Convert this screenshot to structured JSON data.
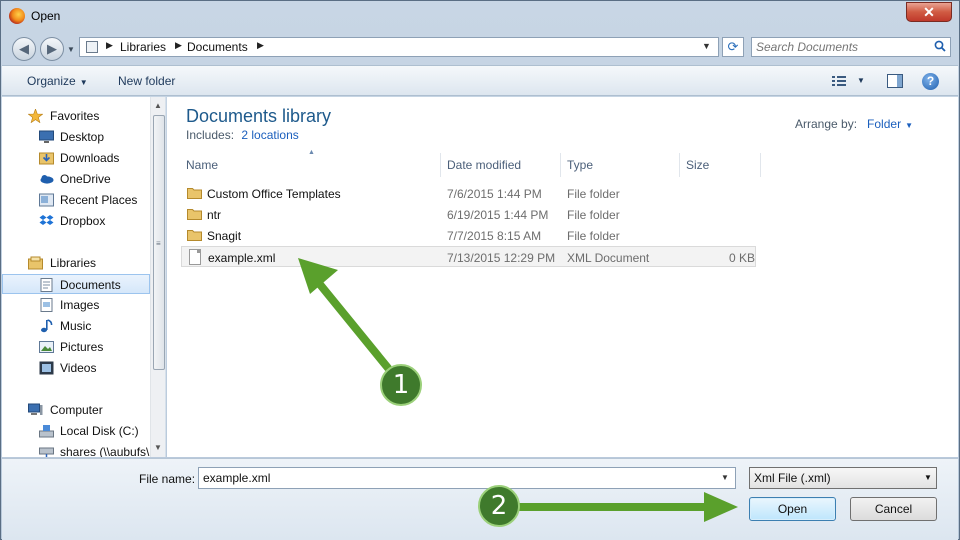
{
  "window": {
    "title": "Open",
    "close_glyph": "✕"
  },
  "address": {
    "crumbs": [
      "Libraries",
      "Documents"
    ],
    "search_placeholder": "Search Documents"
  },
  "toolbar": {
    "organize": "Organize",
    "new_folder": "New folder",
    "help_glyph": "?"
  },
  "nav": {
    "favorites": "Favorites",
    "favorites_items": [
      "Desktop",
      "Downloads",
      "OneDrive",
      "Recent Places",
      "Dropbox"
    ],
    "libraries": "Libraries",
    "libraries_items": [
      "Documents",
      "Images",
      "Music",
      "Pictures",
      "Videos"
    ],
    "computer": "Computer",
    "computer_items": [
      "Local Disk (C:)",
      "shares (\\\\aubufs\\"
    ]
  },
  "content": {
    "title": "Documents library",
    "includes_label": "Includes:",
    "includes_link": "2 locations",
    "arrange_label": "Arrange by:",
    "arrange_value": "Folder",
    "columns": {
      "name": "Name",
      "date": "Date modified",
      "type": "Type",
      "size": "Size"
    },
    "rows": [
      {
        "name": "Custom Office Templates",
        "date": "7/6/2015 1:44 PM",
        "type": "File folder",
        "size": "",
        "kind": "folder"
      },
      {
        "name": "ntr",
        "date": "6/19/2015 1:44 PM",
        "type": "File folder",
        "size": "",
        "kind": "folder"
      },
      {
        "name": "Snagit",
        "date": "7/7/2015 8:15 AM",
        "type": "File folder",
        "size": "",
        "kind": "folder"
      },
      {
        "name": "example.xml",
        "date": "7/13/2015 12:29 PM",
        "type": "XML Document",
        "size": "0 KB",
        "kind": "file"
      }
    ]
  },
  "bottom": {
    "filename_label": "File name:",
    "filename_value": "example.xml",
    "filetype_value": "Xml File (.xml)",
    "open": "Open",
    "cancel": "Cancel"
  },
  "annotations": {
    "step1": "1",
    "step2": "2",
    "color": "#5aa02c"
  }
}
